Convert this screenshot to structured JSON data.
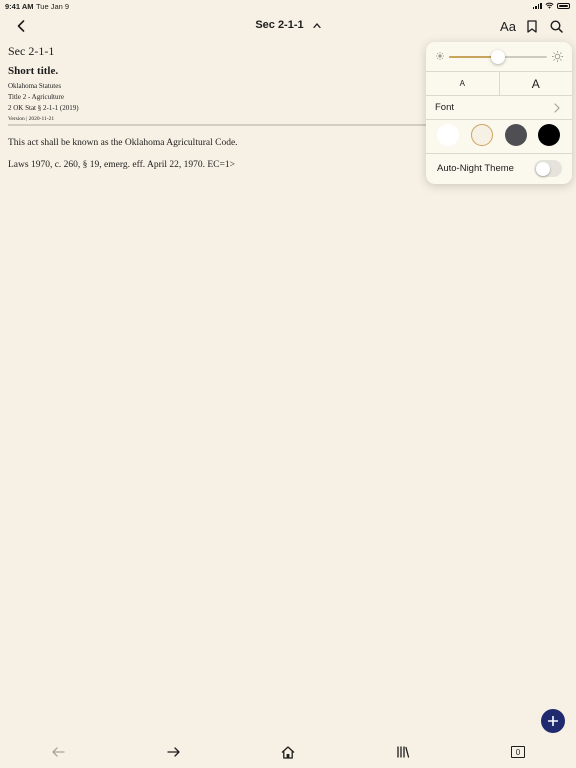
{
  "status": {
    "time": "9:41 AM",
    "date": "Tue Jan 9"
  },
  "nav": {
    "title": "Sec 2-1-1",
    "font_button": "Aa"
  },
  "document": {
    "section_id": "Sec 2-1-1",
    "short_title": "Short title.",
    "meta": [
      "Oklahoma Statutes",
      "Title 2 - Agriculture",
      "2 OK Stat § 2-1-1 (2019)"
    ],
    "version": "Version | 2020-11-21",
    "paragraphs": [
      "This act shall be known as the Oklahoma Agricultural Code.",
      "Laws 1970, c. 260, § 19, emerg. eff. April 22, 1970. EC=1>"
    ]
  },
  "display_settings": {
    "brightness": 0.5,
    "font_size_smaller": "A",
    "font_size_larger": "A",
    "font_label": "Font",
    "themes": [
      "#ffffff",
      "#f7f1e5",
      "#4f4f53",
      "#000000"
    ],
    "selected_theme": 1,
    "auto_night_label": "Auto-Night Theme",
    "auto_night_enabled": false
  },
  "colors": {
    "background": "#f7f1e5",
    "accent": "#c9a45d",
    "fab": "#1f2b6e"
  },
  "tabbar": {
    "tabs_count": "0"
  }
}
